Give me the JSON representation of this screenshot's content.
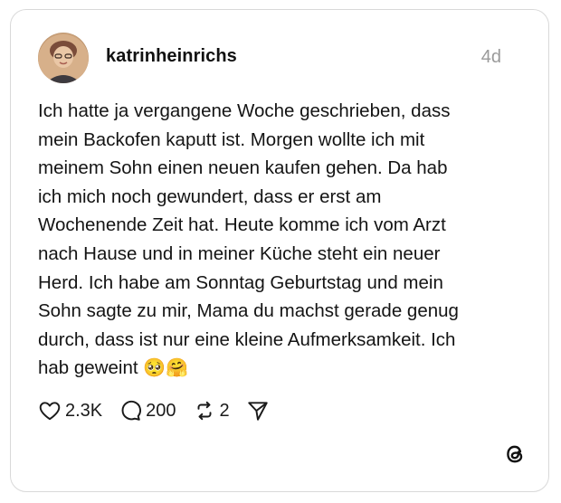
{
  "post": {
    "username": "katrinheinrichs",
    "time_ago": "4d",
    "text": "Ich hatte ja vergangene Woche geschrieben, dass\nmein Backofen kaputt ist. Morgen  wollte ich mit\nmeinem Sohn einen neuen kaufen gehen. Da hab\nich mich noch gewundert, dass er erst am\nWochenende Zeit hat. Heute komme ich vom Arzt\nnach Hause und in meiner Küche steht ein neuer\nHerd. Ich habe am Sonntag Geburtstag und mein\nSohn sagte zu mir, Mama du machst gerade genug\ndurch, dass ist nur eine kleine Aufmerksamkeit.  Ich\nhab geweint ",
    "emojis": "🥺🤗"
  },
  "actions": {
    "likes": "2.3K",
    "replies": "200",
    "reposts": "2"
  },
  "icons": {
    "like": "heart-icon",
    "reply": "comment-bubble-icon",
    "repost": "repost-icon",
    "share": "send-icon",
    "brand": "threads-logo-icon"
  }
}
